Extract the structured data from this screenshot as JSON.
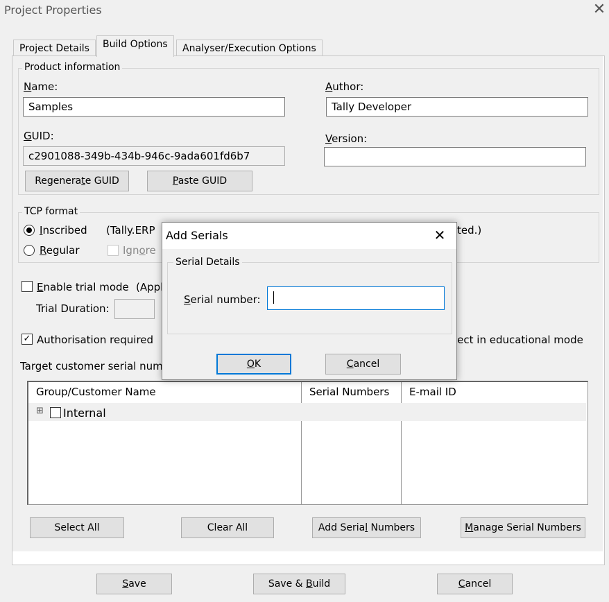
{
  "window": {
    "title": "Project Properties"
  },
  "tabs": [
    {
      "label": "Project Details"
    },
    {
      "label": "Build Options"
    },
    {
      "label": "Analyser/Execution Options"
    }
  ],
  "product_info": {
    "legend": "Product information",
    "name_label_u": "N",
    "name_label_rest": "ame:",
    "name_value": "Samples",
    "author_label_u": "A",
    "author_label_rest": "uthor:",
    "author_value": "Tally Developer",
    "guid_label_u": "G",
    "guid_label_rest": "UID:",
    "guid_value": "c2901088-349b-434b-946c-9ada601fd6b7",
    "version_label_u": "V",
    "version_label_rest": "ersion:",
    "version_value": "",
    "regen_pre": "Regenera",
    "regen_u": "t",
    "regen_post": "e GUID",
    "paste_u": "P",
    "paste_rest": "aste GUID"
  },
  "tcp_format": {
    "legend": "TCP format",
    "inscribed_u": "I",
    "inscribed_rest": "nscribed",
    "inscribed_note": "(Tally.ERP",
    "inscribed_note_right": "ted.)",
    "regular_u": "R",
    "regular_rest": "egular",
    "ignore_pre": "Ign",
    "ignore_u": "o",
    "ignore_post": "re"
  },
  "trial": {
    "enable_u": "E",
    "enable_rest": "nable trial mode",
    "enable_note": "(Appl",
    "duration_label": "Trial Duration:"
  },
  "auth": {
    "label": "Authorisation required",
    "edu_note": "ject in educational mode",
    "target_label": "Target customer serial numb"
  },
  "grid": {
    "columns": [
      "Group/Customer Name",
      "Serial Numbers",
      "E-mail ID"
    ],
    "rows": [
      {
        "name": "Internal",
        "expand": "⊞"
      }
    ]
  },
  "grid_buttons": {
    "select_all": "Select All",
    "clear_all": "Clear All",
    "add_pre": "Add Seria",
    "add_u": "l",
    "add_post": " Numbers",
    "manage_u": "M",
    "manage_rest": "anage Serial Numbers"
  },
  "footer": {
    "save_u": "S",
    "save_rest": "ave",
    "save_build_pre": "Save & ",
    "save_build_u": "B",
    "save_build_post": "uild",
    "cancel_u": "C",
    "cancel_rest": "ancel"
  },
  "dialog": {
    "title": "Add Serials",
    "legend": "Serial Details",
    "serial_u": "S",
    "serial_rest": "erial number:",
    "serial_value": "",
    "ok_u": "O",
    "ok_rest": "K",
    "cancel_u": "C",
    "cancel_rest": "ancel"
  },
  "colors": {
    "accent": "#0078d7",
    "window_bg": "#f0f0f0"
  }
}
